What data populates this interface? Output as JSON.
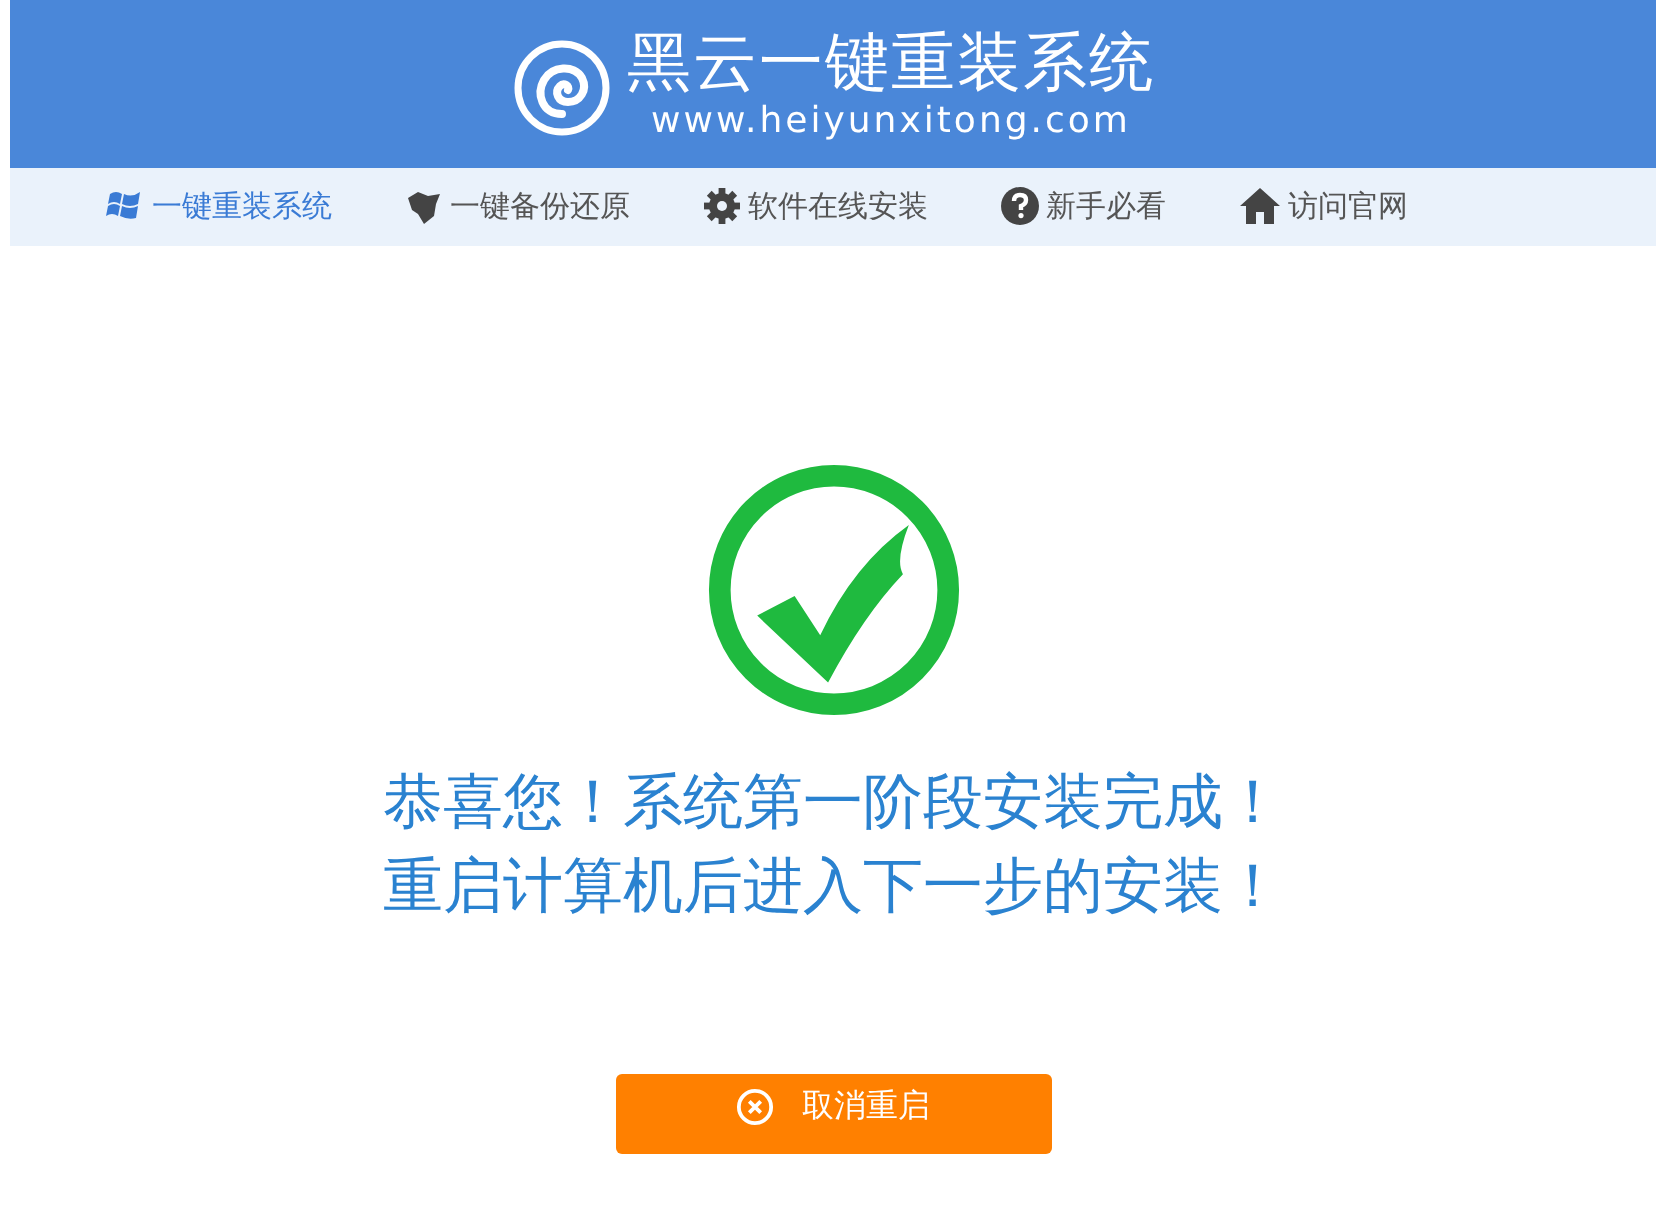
{
  "header": {
    "title": "黑云一键重装系统",
    "url": "www.heiyunxitong.com"
  },
  "nav": [
    {
      "label": "一键重装系统",
      "kind": "windows",
      "selected": true
    },
    {
      "label": "一键备份还原",
      "kind": "thumb",
      "selected": false
    },
    {
      "label": "软件在线安装",
      "kind": "gear",
      "selected": false
    },
    {
      "label": "新手必看",
      "kind": "help",
      "selected": false
    },
    {
      "label": "访问官网",
      "kind": "home",
      "selected": false
    }
  ],
  "message": [
    "恭喜您！系统第一阶段安装完成！",
    "重启计算机后进入下一步的安装！"
  ],
  "cancel_button": "取消重启"
}
